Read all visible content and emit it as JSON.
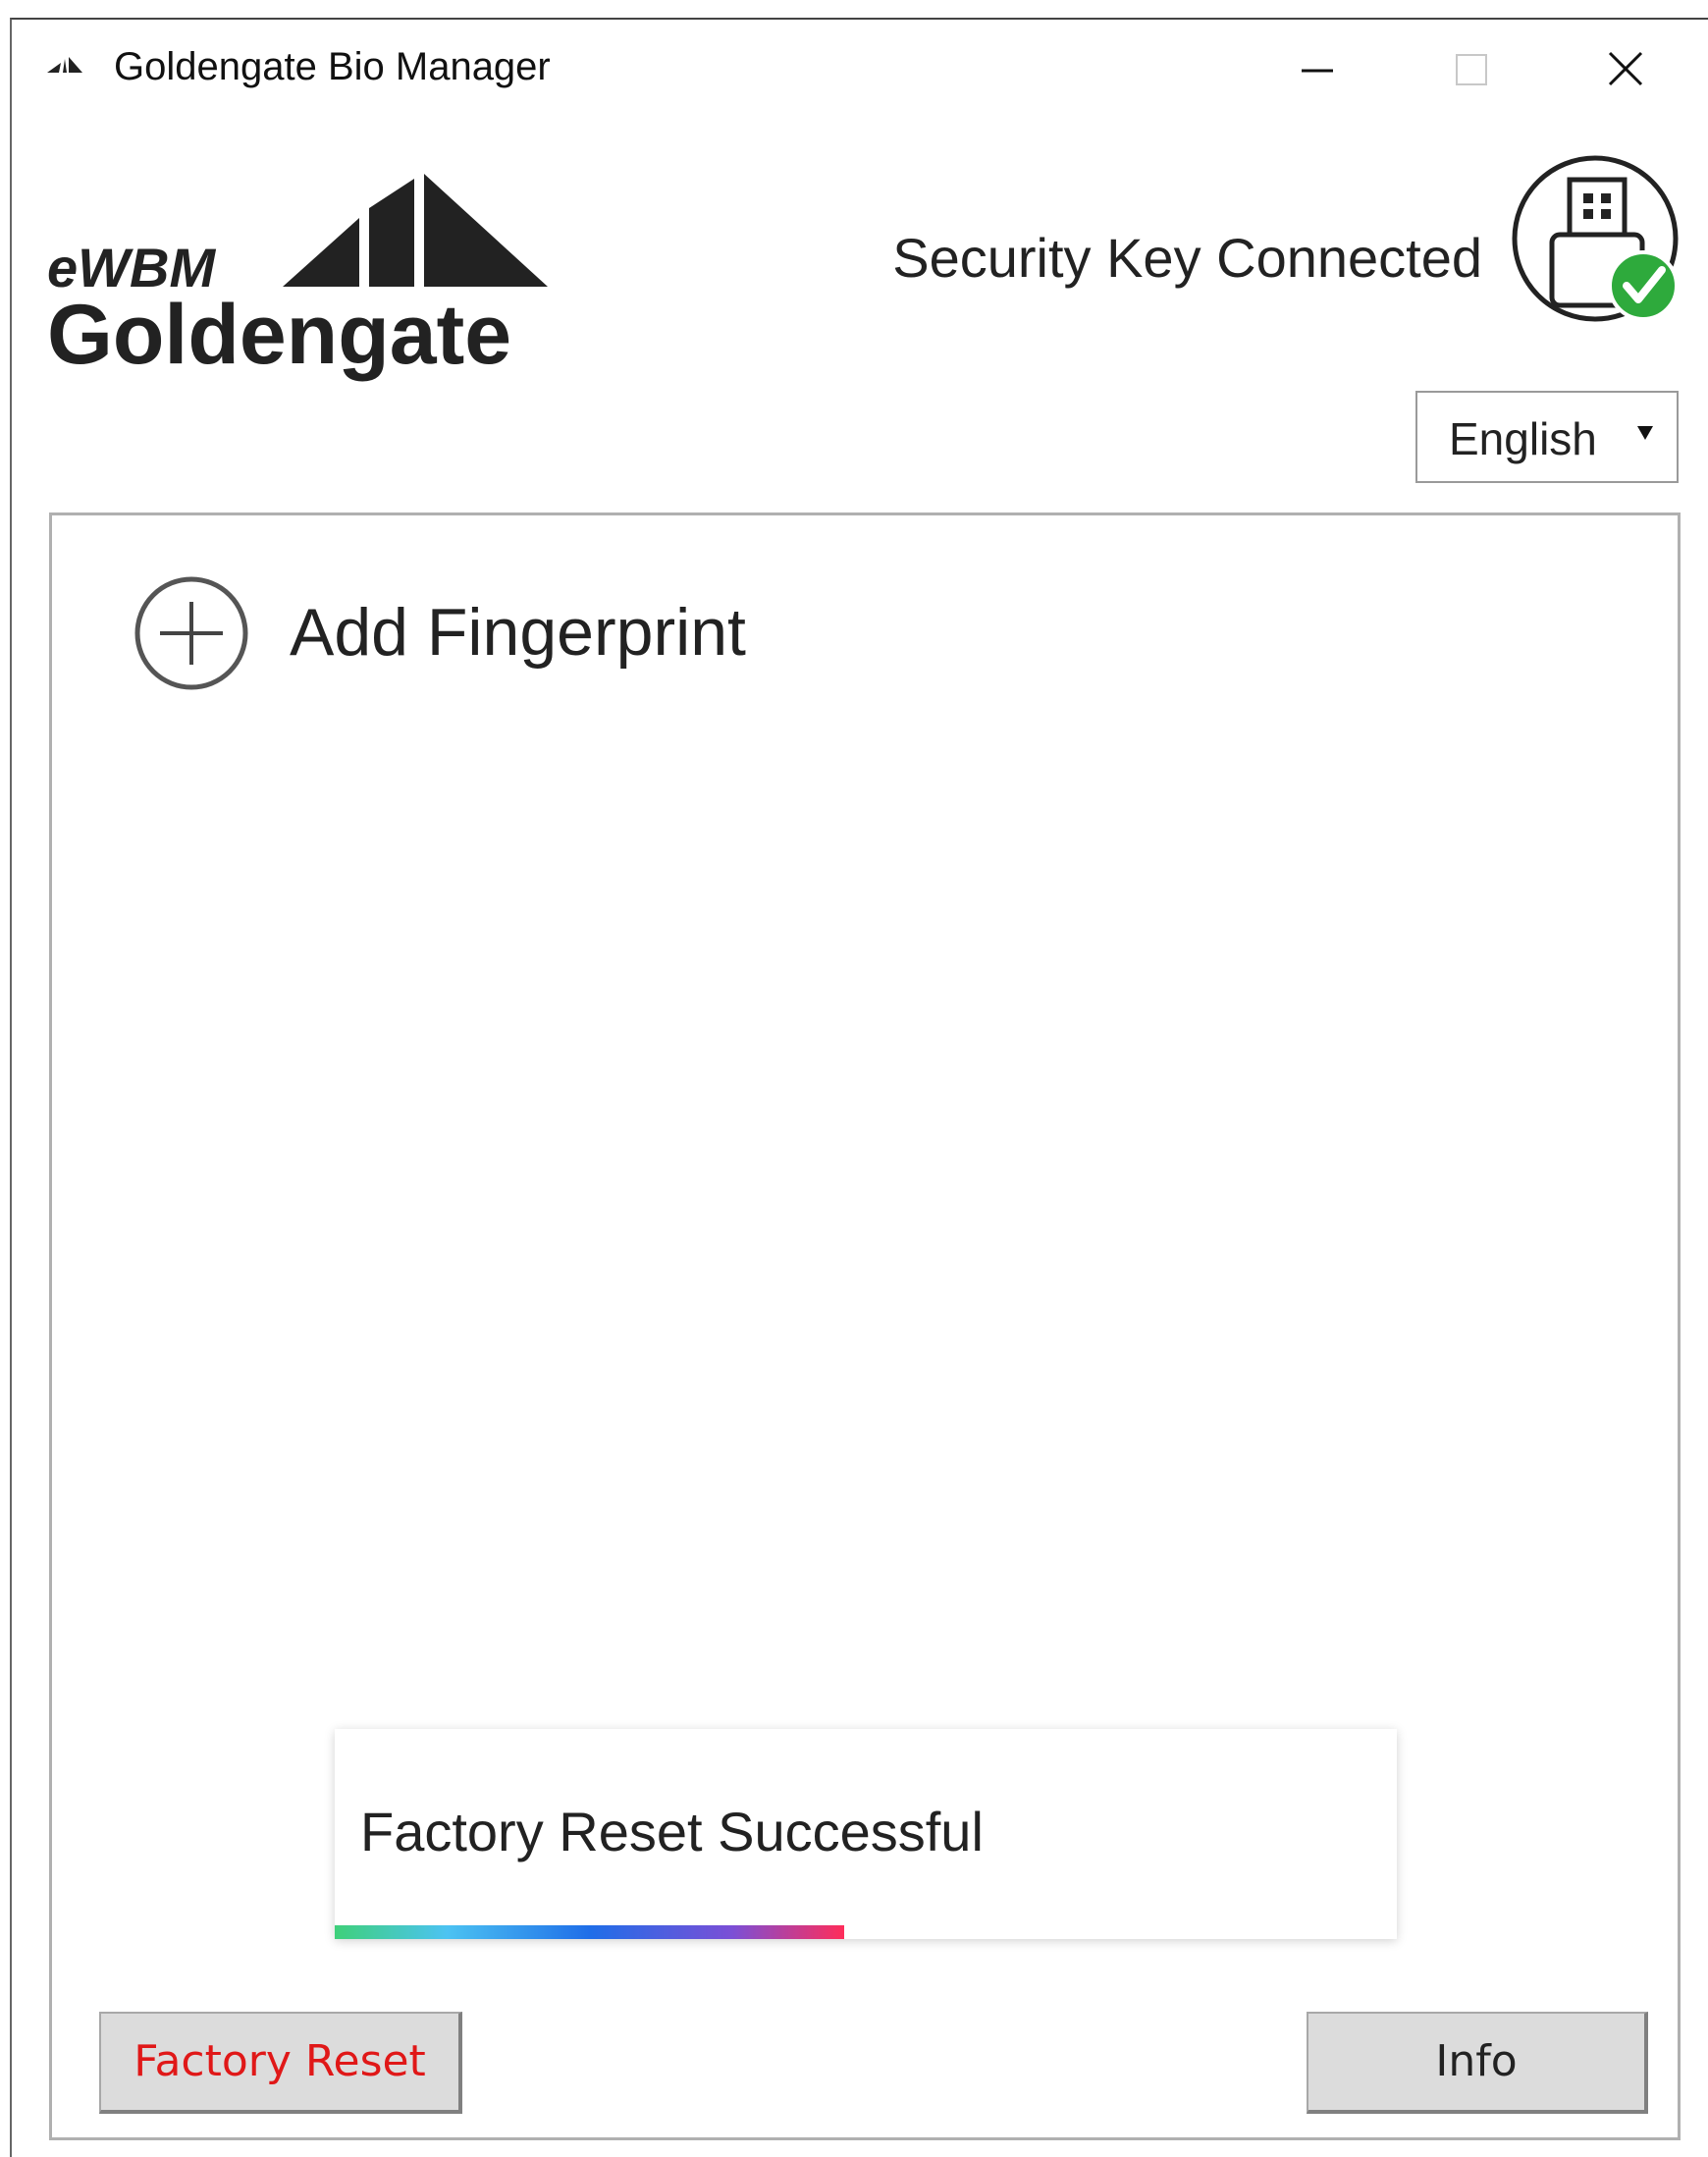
{
  "window": {
    "title": "Goldengate Bio Manager",
    "app_icon": "goldengate-mini-icon",
    "controls": [
      "minimize-icon",
      "maximize-icon",
      "close-icon"
    ]
  },
  "header": {
    "logo_top_text": "eWBM",
    "logo_bottom_text": "Goldengate",
    "status_text": "Security Key Connected",
    "status_icon": "usb-key-connected-icon",
    "status_color": "#2eaa3c"
  },
  "language": {
    "selected": "English"
  },
  "main": {
    "add_fingerprint_label": "Add Fingerprint",
    "add_icon": "plus-circle-icon"
  },
  "toast": {
    "message": "Factory Reset Successful",
    "progress": 0.48
  },
  "footer": {
    "factory_reset_label": "Factory Reset",
    "factory_reset_color": "#e01818",
    "info_label": "Info"
  }
}
